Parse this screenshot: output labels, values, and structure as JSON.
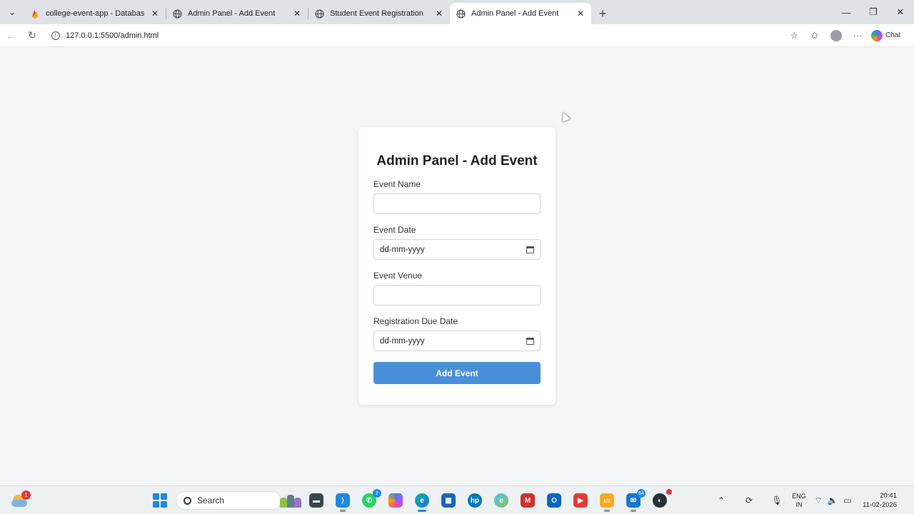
{
  "browser": {
    "tabs": [
      {
        "title": "college-event-app - Database - D",
        "favicon": "firebase-icon",
        "active": false
      },
      {
        "title": "Admin Panel - Add Event",
        "favicon": "globe-icon",
        "active": false
      },
      {
        "title": "Student Event Registration",
        "favicon": "globe-icon",
        "active": false
      },
      {
        "title": "Admin Panel - Add Event",
        "favicon": "globe-icon",
        "active": true
      }
    ],
    "url": "127.0.0.1:5500/admin.html",
    "chat_label": "Chat"
  },
  "form": {
    "title": "Admin Panel - Add Event",
    "fields": [
      {
        "label": "Event Name",
        "value": "",
        "type": "text"
      },
      {
        "label": "Event Date",
        "value": "dd-mm-yyyy",
        "type": "date"
      },
      {
        "label": "Event Venue",
        "value": "",
        "type": "text"
      },
      {
        "label": "Registration Due Date",
        "value": "dd-mm-yyyy",
        "type": "date"
      }
    ],
    "submit_label": "Add Event",
    "accent_color": "#4a90d9"
  },
  "taskbar": {
    "weather_badge": "1",
    "search_label": "Search",
    "apps": [
      {
        "name": "file-manager-icon",
        "badge": ""
      },
      {
        "name": "vscode-icon",
        "badge": ""
      },
      {
        "name": "whatsapp-icon",
        "badge": "2"
      },
      {
        "name": "copilot-icon",
        "badge": ""
      },
      {
        "name": "edge-icon",
        "badge": ""
      },
      {
        "name": "store-icon",
        "badge": ""
      },
      {
        "name": "hp-icon",
        "badge": ""
      },
      {
        "name": "edge-dev-icon",
        "badge": ""
      },
      {
        "name": "mcafee-icon",
        "badge": ""
      },
      {
        "name": "outlook-icon",
        "badge": ""
      },
      {
        "name": "youtube-icon",
        "badge": ""
      },
      {
        "name": "folder-icon",
        "badge": ""
      },
      {
        "name": "mail-icon",
        "badge": "64"
      },
      {
        "name": "github-desktop-icon",
        "badge": ""
      }
    ],
    "lang_line1": "ENG",
    "lang_line2": "IN",
    "time": "20:41",
    "date": "11-02-2026"
  }
}
